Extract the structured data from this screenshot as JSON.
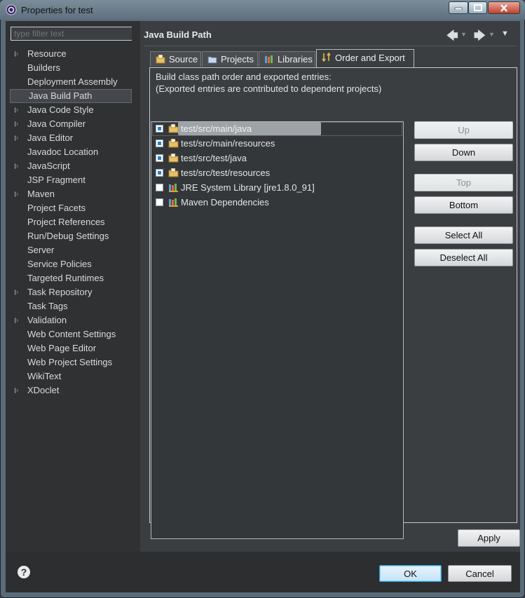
{
  "window": {
    "title": "Properties for test"
  },
  "filter": {
    "placeholder": "type filter text"
  },
  "nav": {
    "items": [
      {
        "label": "Resource",
        "expandable": true
      },
      {
        "label": "Builders",
        "expandable": false
      },
      {
        "label": "Deployment Assembly",
        "expandable": false
      },
      {
        "label": "Java Build Path",
        "expandable": false,
        "selected": true
      },
      {
        "label": "Java Code Style",
        "expandable": true
      },
      {
        "label": "Java Compiler",
        "expandable": true
      },
      {
        "label": "Java Editor",
        "expandable": true
      },
      {
        "label": "Javadoc Location",
        "expandable": false
      },
      {
        "label": "JavaScript",
        "expandable": true
      },
      {
        "label": "JSP Fragment",
        "expandable": false
      },
      {
        "label": "Maven",
        "expandable": true
      },
      {
        "label": "Project Facets",
        "expandable": false
      },
      {
        "label": "Project References",
        "expandable": false
      },
      {
        "label": "Run/Debug Settings",
        "expandable": false
      },
      {
        "label": "Server",
        "expandable": false
      },
      {
        "label": "Service Policies",
        "expandable": false
      },
      {
        "label": "Targeted Runtimes",
        "expandable": false
      },
      {
        "label": "Task Repository",
        "expandable": true
      },
      {
        "label": "Task Tags",
        "expandable": false
      },
      {
        "label": "Validation",
        "expandable": true
      },
      {
        "label": "Web Content Settings",
        "expandable": false
      },
      {
        "label": "Web Page Editor",
        "expandable": false
      },
      {
        "label": "Web Project Settings",
        "expandable": false
      },
      {
        "label": "WikiText",
        "expandable": false
      },
      {
        "label": "XDoclet",
        "expandable": true
      }
    ]
  },
  "page": {
    "title": "Java Build Path"
  },
  "tabs": [
    {
      "label": "Source"
    },
    {
      "label": "Projects"
    },
    {
      "label": "Libraries"
    },
    {
      "label": "Order and Export",
      "active": true
    }
  ],
  "order": {
    "desc1": "Build class path order and exported entries:",
    "desc2": "(Exported entries are contributed to dependent projects)",
    "entries": [
      {
        "label": "test/src/main/java",
        "checked": true,
        "selected": true
      },
      {
        "label": "test/src/main/resources",
        "checked": true
      },
      {
        "label": "test/src/test/java",
        "checked": true
      },
      {
        "label": "test/src/test/resources",
        "checked": true
      },
      {
        "label": "JRE System Library [jre1.8.0_91]",
        "checked": false
      },
      {
        "label": "Maven Dependencies",
        "checked": false
      }
    ],
    "buttons": {
      "up": "Up",
      "down": "Down",
      "top": "Top",
      "bottom": "Bottom",
      "select_all": "Select All",
      "deselect_all": "Deselect All"
    }
  },
  "apply_label": "Apply",
  "footer": {
    "ok_label": "OK",
    "cancel_label": "Cancel"
  }
}
